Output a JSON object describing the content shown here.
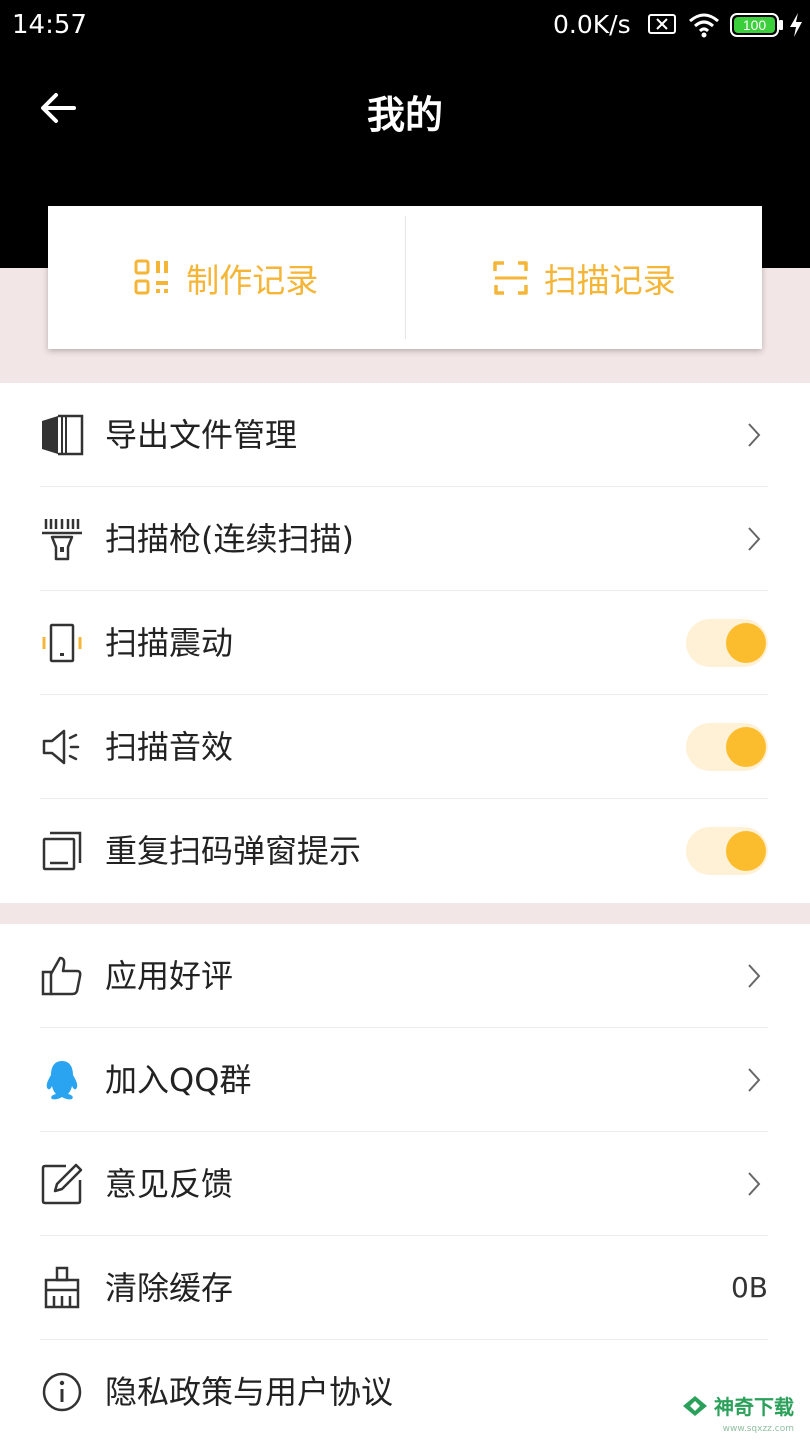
{
  "status_bar": {
    "time": "14:57",
    "network_speed": "0.0K/s",
    "battery": "100",
    "icons": [
      "sim-x-icon",
      "wifi-icon",
      "battery-icon",
      "charging-icon"
    ]
  },
  "header": {
    "title": "我的",
    "back_icon": "arrow-left-icon"
  },
  "records": {
    "make_label": "制作记录",
    "scan_label": "扫描记录"
  },
  "settings": [
    {
      "label": "导出文件管理",
      "icon": "book-icon",
      "type": "chevron"
    },
    {
      "label": "扫描枪(连续扫描)",
      "icon": "barcode-scanner-icon",
      "type": "chevron"
    },
    {
      "label": "扫描震动",
      "icon": "vibrate-icon",
      "type": "toggle",
      "on": true
    },
    {
      "label": "扫描音效",
      "icon": "speaker-icon",
      "type": "toggle",
      "on": true
    },
    {
      "label": "重复扫码弹窗提示",
      "icon": "copy-icon",
      "type": "toggle",
      "on": true
    }
  ],
  "others": [
    {
      "label": "应用好评",
      "icon": "thumbs-up-icon",
      "type": "chevron"
    },
    {
      "label": "加入QQ群",
      "icon": "qq-penguin-icon",
      "type": "chevron"
    },
    {
      "label": "意见反馈",
      "icon": "edit-icon",
      "type": "chevron"
    },
    {
      "label": "清除缓存",
      "icon": "broom-icon",
      "type": "value",
      "value": "0B"
    },
    {
      "label": "隐私政策与用户协议",
      "icon": "info-icon",
      "type": "none"
    }
  ],
  "watermark": {
    "text": "神奇下载",
    "sub": "www.sqxzz.com"
  },
  "colors": {
    "accent": "#f5b536",
    "toggle_knob": "#fbbd2e",
    "toggle_track": "#fff1d6",
    "header_bg": "#000000",
    "band_bg": "#f3e6e6"
  }
}
